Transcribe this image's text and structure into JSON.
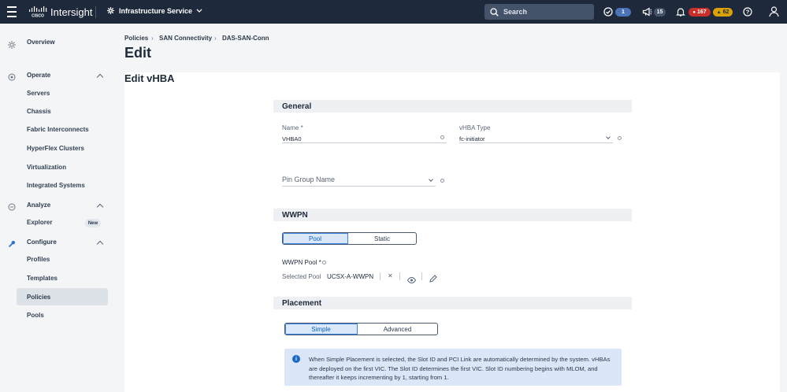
{
  "topbar": {
    "product": "Intersight",
    "service": "Infrastructure Service",
    "search_placeholder": "Search",
    "tasks_count": "1",
    "notifications_count": "15",
    "critical_alarms": "167",
    "warning_alarms": "62",
    "colors": {
      "bg": "#1e2a3c",
      "critical": "#d93a3a",
      "warning": "#e0a40a",
      "badge": "#4a73b8"
    }
  },
  "sidebar": {
    "overview": "Overview",
    "operate": "Operate",
    "operate_items": [
      "Servers",
      "Chassis",
      "Fabric Interconnects",
      "HyperFlex Clusters",
      "Virtualization",
      "Integrated Systems"
    ],
    "analyze": "Analyze",
    "explorer": "Explorer",
    "explorer_badge": "New",
    "configure": "Configure",
    "configure_items": [
      "Profiles",
      "Templates",
      "Policies",
      "Pools"
    ]
  },
  "breadcrumb": [
    "Policies",
    "SAN Connectivity",
    "DAS-SAN-Conn"
  ],
  "page_title": "Edit",
  "card_title": "Edit vHBA",
  "general": {
    "title": "General",
    "name_label": "Name *",
    "name_value": "VHBA0",
    "vhba_type_label": "vHBA Type",
    "vhba_type_value": "fc-initiator",
    "pin_group_label": "Pin Group Name"
  },
  "wwpn": {
    "title": "WWPN",
    "tabs": [
      "Pool",
      "Static"
    ],
    "pool_label": "WWPN Pool *",
    "selected_label": "Selected Pool",
    "selected_value": "UCSX-A-WWPN"
  },
  "placement": {
    "title": "Placement",
    "tabs": [
      "Simple",
      "Advanced"
    ],
    "info_text": "When Simple Placement is selected, the Slot ID and PCI Link are automatically determined by the system. vHBAs are deployed on the first VIC. The Slot ID determines the first VIC. Slot ID numbering begins with MLOM, and thereafter it keeps incrementing by 1, starting from 1."
  }
}
